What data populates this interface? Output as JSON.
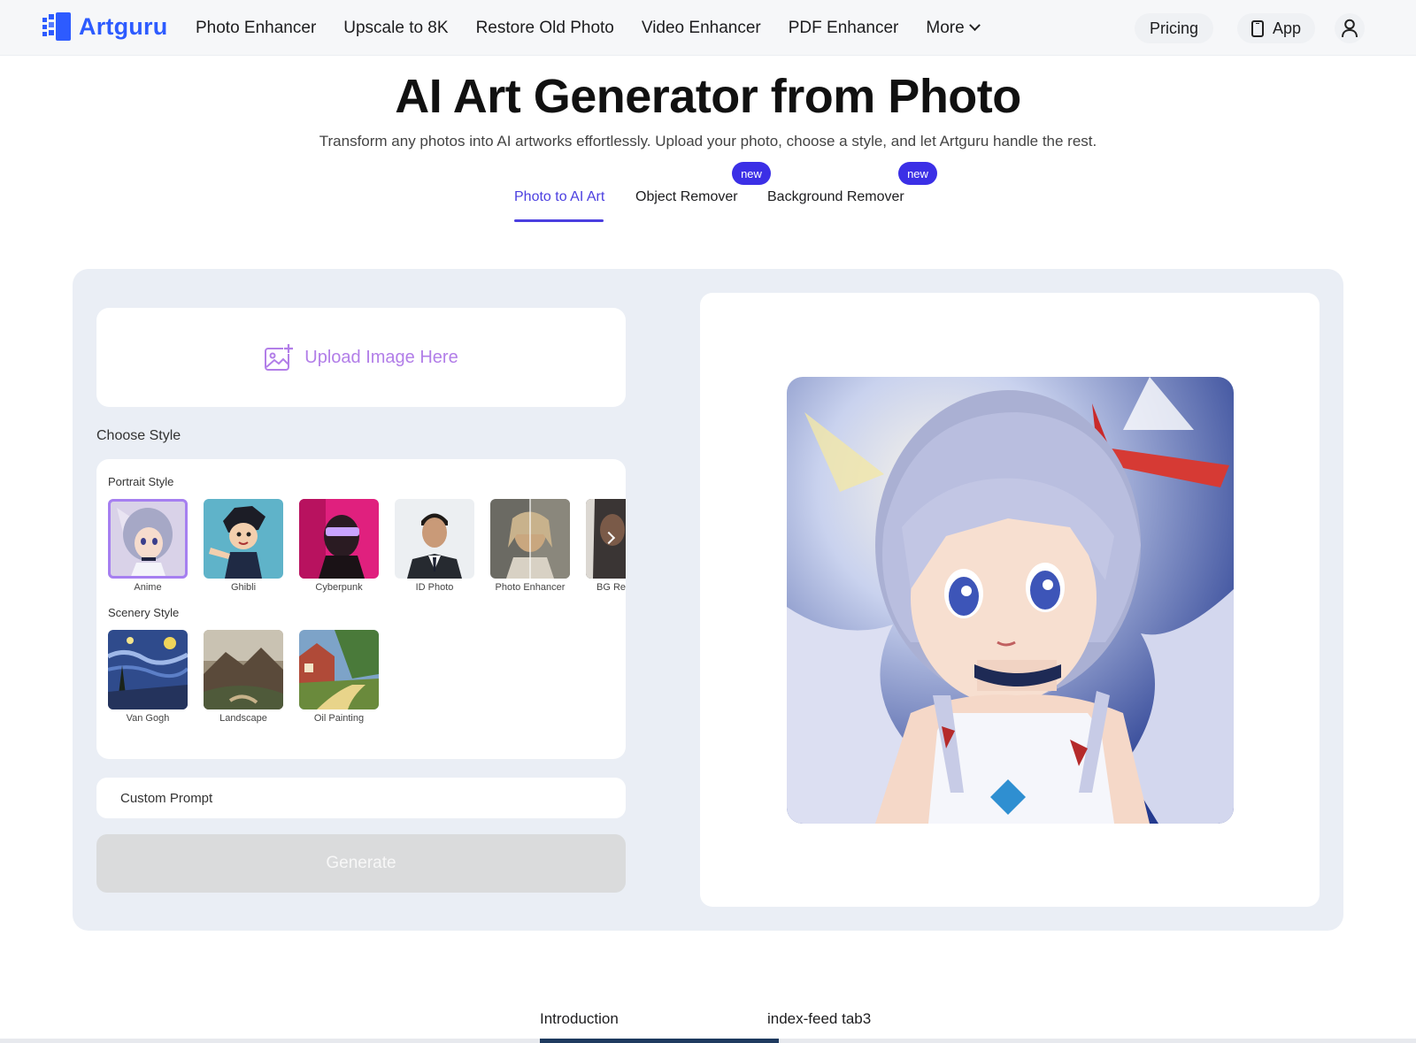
{
  "nav": {
    "brand": "Artguru",
    "links": [
      {
        "label": "Photo Enhancer"
      },
      {
        "label": "Upscale to 8K"
      },
      {
        "label": "Restore Old Photo"
      },
      {
        "label": "Video Enhancer"
      },
      {
        "label": "PDF Enhancer"
      },
      {
        "label": "More"
      }
    ],
    "pricing_label": "Pricing",
    "app_label": "App",
    "brand_color": "#2d5bff"
  },
  "hero": {
    "title": "AI Art Generator from Photo",
    "subtitle": "Transform any photos into AI artworks effortlessly. Upload your photo, choose a style, and let Artguru handle the rest."
  },
  "tabs": [
    {
      "label": "Photo to AI Art",
      "active": true,
      "badge": ""
    },
    {
      "label": "Object Remover",
      "active": false,
      "badge": "new"
    },
    {
      "label": "Background Remover",
      "active": false,
      "badge": "new"
    }
  ],
  "upload": {
    "label": "Upload Image Here"
  },
  "styles": {
    "heading": "Choose Style",
    "portrait": {
      "label": "Portrait Style",
      "items": [
        {
          "label": "Anime",
          "selected": true
        },
        {
          "label": "Ghibli",
          "selected": false
        },
        {
          "label": "Cyberpunk",
          "selected": false
        },
        {
          "label": "ID Photo",
          "selected": false
        },
        {
          "label": "Photo Enhancer",
          "selected": false
        },
        {
          "label": "BG Re",
          "selected": false
        }
      ]
    },
    "scenery": {
      "label": "Scenery Style",
      "items": [
        {
          "label": "Van Gogh"
        },
        {
          "label": "Landscape"
        },
        {
          "label": "Oil Painting"
        }
      ]
    }
  },
  "prompt": {
    "placeholder": "Custom Prompt",
    "value": ""
  },
  "generate": {
    "label": "Generate"
  },
  "bottom_tabs": [
    {
      "label": "Introduction"
    },
    {
      "label": "index-feed tab3"
    }
  ],
  "colors": {
    "accent": "#4b3fe0",
    "badge": "#3b2fe6",
    "upload": "#b27ee8",
    "panel": "#eaeef5"
  }
}
